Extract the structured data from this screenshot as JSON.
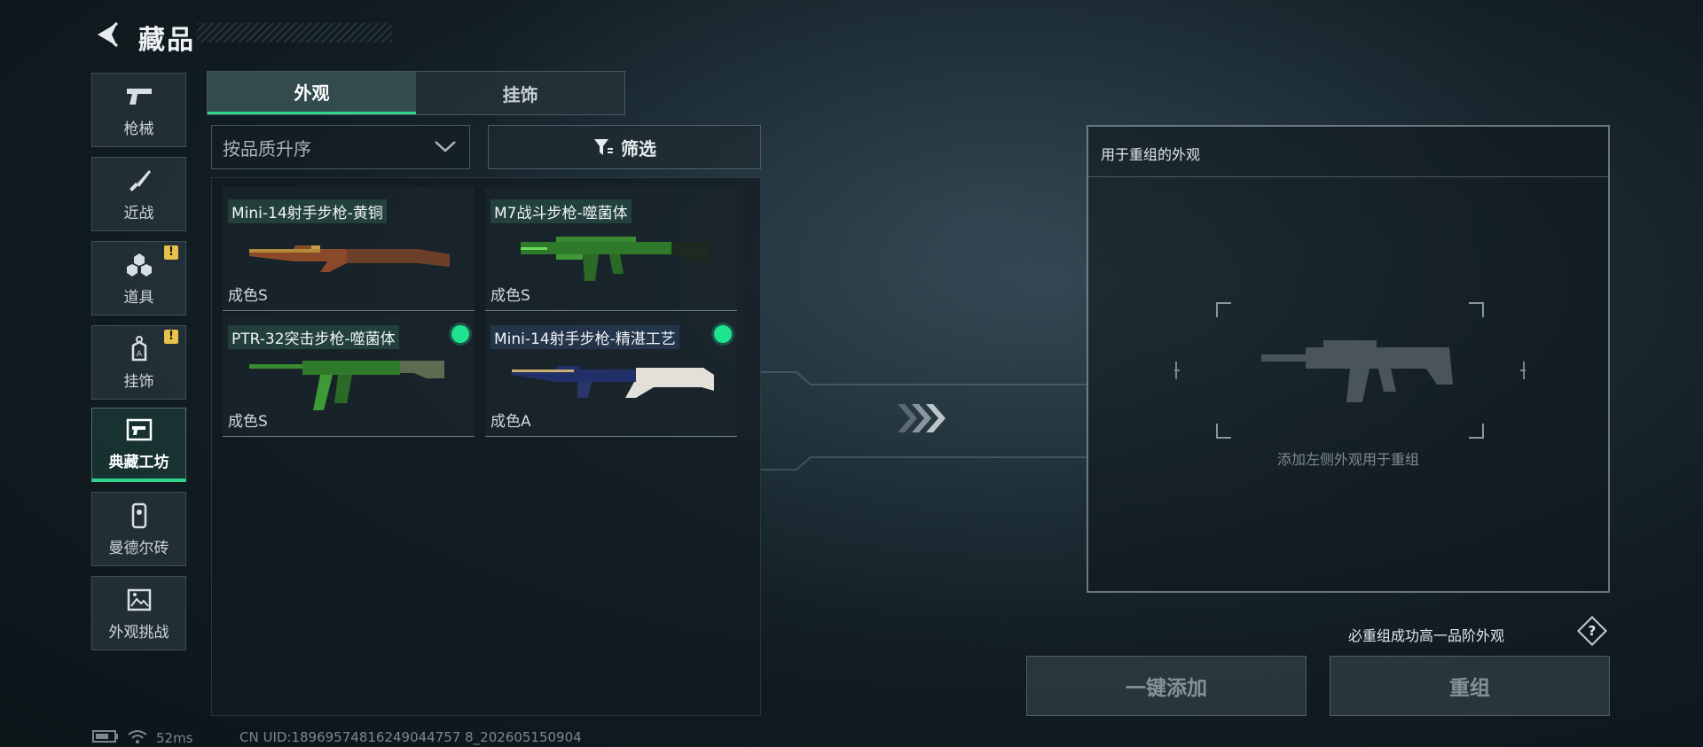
{
  "header": {
    "title": "藏品",
    "back_icon": "back-arrow-icon"
  },
  "sidebar": {
    "items": [
      {
        "label": "枪械",
        "icon": "pistol-icon",
        "warning": false,
        "active": false
      },
      {
        "label": "近战",
        "icon": "knife-icon",
        "warning": false,
        "active": false
      },
      {
        "label": "道具",
        "icon": "grenade-cluster-icon",
        "warning": true,
        "active": false
      },
      {
        "label": "挂饰",
        "icon": "charm-tag-icon",
        "warning": true,
        "active": false
      },
      {
        "label": "典藏工坊",
        "icon": "workshop-frame-icon",
        "warning": false,
        "active": true
      },
      {
        "label": "曼德尔砖",
        "icon": "brick-icon",
        "warning": false,
        "active": false
      },
      {
        "label": "外观挑战",
        "icon": "challenge-image-icon",
        "warning": false,
        "active": false
      }
    ],
    "warning_mark": "!"
  },
  "tabs": [
    {
      "label": "外观",
      "active": true
    },
    {
      "label": "挂饰",
      "active": false
    }
  ],
  "sort": {
    "value": "按品质升序"
  },
  "filter": {
    "label": "筛选"
  },
  "cards": [
    {
      "name": "Mini-14射手步枪-黄铜",
      "condition": "成色S",
      "dot": false,
      "tag_color": "#2a5a4e"
    },
    {
      "name": "M7战斗步枪-噬菌体",
      "condition": "成色S",
      "dot": false,
      "tag_color": "#2a5a4e"
    },
    {
      "name": "PTR-32突击步枪-噬菌体",
      "condition": "成色S",
      "dot": true,
      "tag_color": "#2a5a4e"
    },
    {
      "name": "Mini-14射手步枪-精湛工艺",
      "condition": "成色A",
      "dot": true,
      "tag_color": "#2a3c5a"
    }
  ],
  "reassemble": {
    "panel_title": "用于重组的外观",
    "hint": "添加左侧外观用于重组",
    "guarantee": "必重组成功高一品阶外观",
    "help": "?",
    "add_all": "一键添加",
    "reassemble": "重组"
  },
  "status": {
    "ping": "52ms",
    "uid": "CN UID:18969574816249044757 8_202605150904"
  },
  "colors": {
    "accent": "#2fd48c",
    "warning": "#e8c24a",
    "dot": "#1fe38f"
  }
}
